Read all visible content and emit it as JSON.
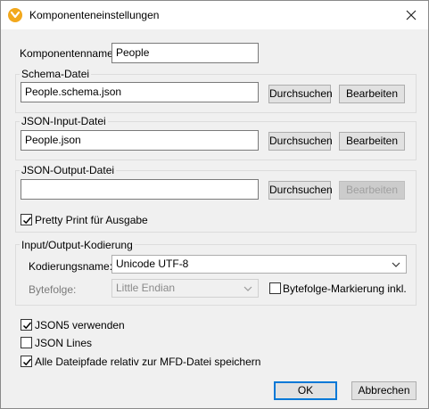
{
  "window": {
    "title": "Komponenteneinstellungen"
  },
  "component": {
    "label": "Komponentenname:",
    "value": "People"
  },
  "schema": {
    "group_title": "Schema-Datei",
    "value": "People.schema.json",
    "browse_label": "Durchsuchen",
    "edit_label": "Bearbeiten"
  },
  "input_file": {
    "group_title": "JSON-Input-Datei",
    "value": "People.json",
    "browse_label": "Durchsuchen",
    "edit_label": "Bearbeiten"
  },
  "output_file": {
    "group_title": "JSON-Output-Datei",
    "value": "",
    "browse_label": "Durchsuchen",
    "edit_label": "Bearbeiten",
    "pretty_print_label": "Pretty Print für Ausgabe",
    "pretty_print_checked": true
  },
  "encoding": {
    "group_title": "Input/Output-Kodierung",
    "name_label": "Kodierungsname:",
    "name_value": "Unicode UTF-8",
    "byteorder_label": "Bytefolge:",
    "byteorder_value": "Little Endian",
    "bom_label": "Bytefolge-Markierung inkl.",
    "bom_checked": false
  },
  "options": {
    "json5_label": "JSON5 verwenden",
    "json5_checked": true,
    "jsonlines_label": "JSON Lines",
    "jsonlines_checked": false,
    "relative_paths_label": "Alle Dateipfade relativ zur MFD-Datei speichern",
    "relative_paths_checked": true
  },
  "footer": {
    "ok_label": "OK",
    "cancel_label": "Abbrechen"
  }
}
